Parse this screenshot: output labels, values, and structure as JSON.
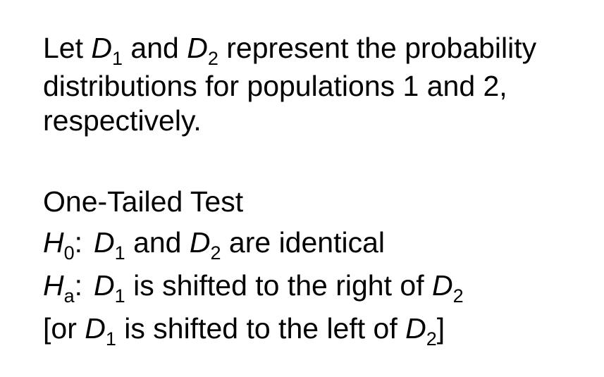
{
  "intro": {
    "line1": {
      "t1": "Let ",
      "v1": "D",
      "s1": "1",
      "t2": " and ",
      "v2": "D",
      "s2": "2",
      "t3": " represent the probability"
    },
    "line2": "distributions for populations 1 and 2,",
    "line3": "respectively."
  },
  "test": {
    "heading": "One-Tailed Test",
    "h0": {
      "label": "H",
      "sub": "0",
      "colon": ":",
      "v1": "D",
      "s1": "1",
      "t1": " and ",
      "v2": "D",
      "s2": "2",
      "t2": " are identical"
    },
    "ha": {
      "label": "H",
      "sub": "a",
      "colon": ":",
      "v1": "D",
      "s1": "1",
      "t1": " is shifted to the right of ",
      "v2": "D",
      "s2": "2"
    },
    "alt": {
      "open": "[or ",
      "v1": "D",
      "s1": "1",
      "t1": " is shifted to the left of ",
      "v2": "D",
      "s2": "2",
      "close": "]"
    }
  }
}
